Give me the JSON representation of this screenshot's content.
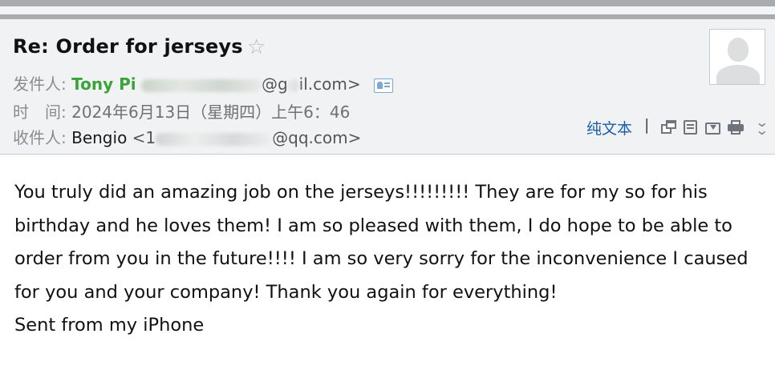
{
  "email": {
    "subject": "Re: Order for jerseys",
    "from": {
      "label": "发件人:",
      "name": "Tony  Pi",
      "address_visible": "il.com>",
      "address_prefix": "@g"
    },
    "time": {
      "label": "时　间:",
      "value": "2024年6月13日（星期四）上午6：46"
    },
    "to": {
      "label": "收件人:",
      "name": "Bengio",
      "address_prefix": "<1",
      "address_visible": "@qq.com>"
    },
    "toolbar": {
      "plain_text": "纯文本",
      "separator": "|"
    },
    "body": [
      "You truly did an amazing job on the jerseys!!!!!!!!! They are for my so for his birthday and he loves them! I am so pleased with them, I do hope to be able to order from you in the future!!!! I am so very sorry for the inconvenience I caused for you and your company! Thank you again for everything!",
      "Sent from my iPhone"
    ]
  },
  "icons": {
    "star": "star-outline-icon",
    "contact": "contact-card-icon",
    "new_window": "new-window-icon",
    "note": "note-icon",
    "save": "save-download-icon",
    "print": "print-icon",
    "more": "chevron-double-down-icon"
  },
  "colors": {
    "sender_name": "#3aa33a",
    "plain_text_link": "#1c5ea8",
    "header_bg": "#f1f2f3"
  }
}
